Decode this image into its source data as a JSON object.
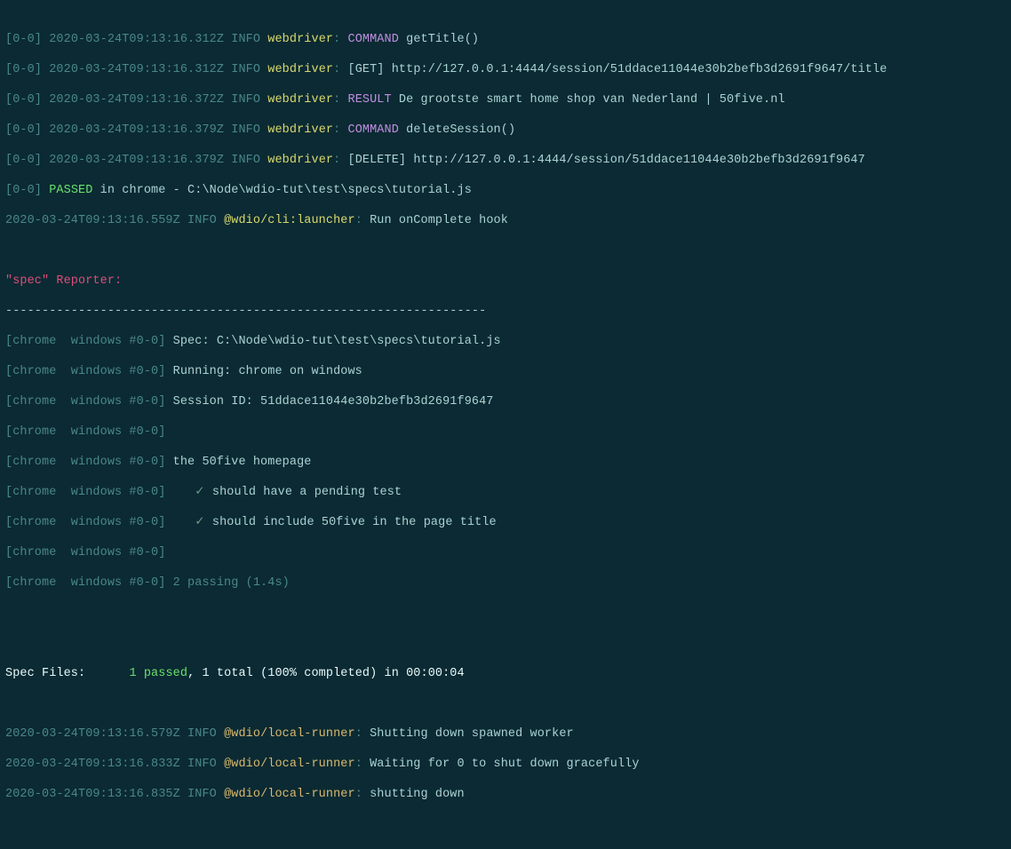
{
  "l1": {
    "w": "[0-0]",
    "ts": "2020-03-24T09:13:16.312Z",
    "lv": "INFO",
    "mod": "webdriver",
    "cmd": "COMMAND",
    "arg": "getTitle()"
  },
  "l2": {
    "w": "[0-0]",
    "ts": "2020-03-24T09:13:16.312Z",
    "lv": "INFO",
    "mod": "webdriver",
    "mth": "[GET]",
    "url": "http://127.0.0.1:4444/session/51ddace11044e30b2befb3d2691f9647/title"
  },
  "l3": {
    "w": "[0-0]",
    "ts": "2020-03-24T09:13:16.372Z",
    "lv": "INFO",
    "mod": "webdriver",
    "res": "RESULT",
    "txt": "De grootste smart home shop van Nederland | 50five.nl"
  },
  "l4": {
    "w": "[0-0]",
    "ts": "2020-03-24T09:13:16.379Z",
    "lv": "INFO",
    "mod": "webdriver",
    "cmd": "COMMAND",
    "arg": "deleteSession()"
  },
  "l5": {
    "w": "[0-0]",
    "ts": "2020-03-24T09:13:16.379Z",
    "lv": "INFO",
    "mod": "webdriver",
    "mth": "[DELETE]",
    "url": "http://127.0.0.1:4444/session/51ddace11044e30b2befb3d2691f9647"
  },
  "l6": {
    "w": "[0-0]",
    "pass": "PASSED",
    "tail": "in chrome - C:\\Node\\wdio-tut\\test\\specs\\tutorial.js"
  },
  "l7": {
    "ts": "2020-03-24T09:13:16.559Z",
    "lv": "INFO",
    "mod": "@wdio/cli:launcher",
    "txt": "Run onComplete hook"
  },
  "rep": {
    "hdr": "\"spec\" Reporter:",
    "sep": "------------------------------------------------------------------"
  },
  "r1": {
    "p": "[chrome  windows #0-0]",
    "t": "Spec: C:\\Node\\wdio-tut\\test\\specs\\tutorial.js"
  },
  "r2": {
    "p": "[chrome  windows #0-0]",
    "t": "Running: chrome on windows"
  },
  "r3": {
    "p": "[chrome  windows #0-0]",
    "t": "Session ID: 51ddace11044e30b2befb3d2691f9647"
  },
  "r4": {
    "p": "[chrome  windows #0-0]",
    "t": ""
  },
  "r5": {
    "p": "[chrome  windows #0-0]",
    "t": "the 50five homepage"
  },
  "r6": {
    "p": "[chrome  windows #0-0]",
    "t": "should have a pending test"
  },
  "r7": {
    "p": "[chrome  windows #0-0]",
    "t": "should include 50five in the page title"
  },
  "r8": {
    "p": "[chrome  windows #0-0]",
    "t": ""
  },
  "r9": {
    "p": "[chrome  windows #0-0]",
    "t": "2 passing (1.4s)"
  },
  "sf": {
    "label": "Spec Files:",
    "pass": "1 passed",
    "tail": ", 1 total (100% completed) in 00:00:04"
  },
  "f1": {
    "ts": "2020-03-24T09:13:16.579Z",
    "lv": "INFO",
    "mod": "@wdio/local-runner",
    "t": "Shutting down spawned worker"
  },
  "f2": {
    "ts": "2020-03-24T09:13:16.833Z",
    "lv": "INFO",
    "mod": "@wdio/local-runner",
    "t": "Waiting for 0 to shut down gracefully"
  },
  "f3": {
    "ts": "2020-03-24T09:13:16.835Z",
    "lv": "INFO",
    "mod": "@wdio/local-runner",
    "t": "shutting down"
  },
  "sym": {
    "check": "✓"
  }
}
